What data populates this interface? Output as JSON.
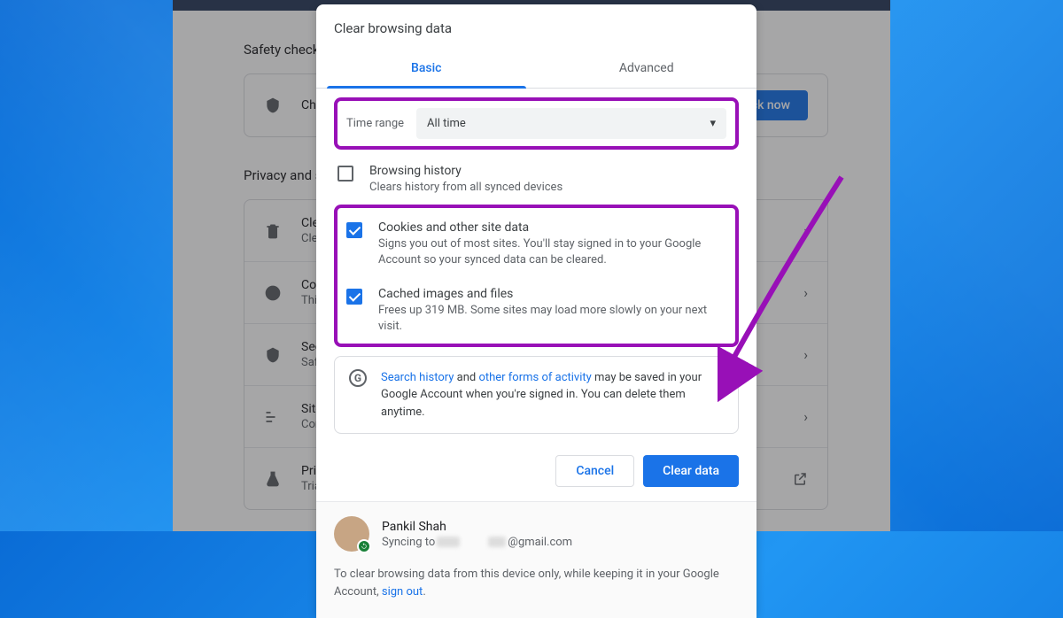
{
  "dialog": {
    "title": "Clear browsing data",
    "tabs": {
      "basic": "Basic",
      "advanced": "Advanced"
    },
    "time_label": "Time range",
    "time_value": "All time",
    "items": [
      {
        "title": "Browsing history",
        "sub": "Clears history from all synced devices"
      },
      {
        "title": "Cookies and other site data",
        "sub": "Signs you out of most sites. You'll stay signed in to your Google Account so your synced data can be cleared."
      },
      {
        "title": "Cached images and files",
        "sub": "Frees up 319 MB. Some sites may load more slowly on your next visit."
      }
    ],
    "info": {
      "link1": "Search history",
      "mid": " and ",
      "link2": "other forms of activity",
      "rest": " may be saved in your Google Account when you're signed in. You can delete them anytime."
    },
    "cancel": "Cancel",
    "clear": "Clear data",
    "user": {
      "name": "Pankil Shah",
      "sync_prefix": "Syncing to ",
      "email_suffix": "@gmail.com"
    },
    "footer": {
      "text": "To clear browsing data from this device only, while keeping it in your Google Account, ",
      "link": "sign out"
    }
  },
  "bg": {
    "safety_label": "Safety check",
    "chrome_text": "Chro",
    "check_now": "eck now",
    "privacy_label": "Privacy and s",
    "rows": [
      {
        "t1": "Clea",
        "t2": "Clea"
      },
      {
        "t1": "Cook",
        "t2": "Thirc"
      },
      {
        "t1": "Secu",
        "t2": "Safe"
      },
      {
        "t1": "Site",
        "t2": "Cont"
      },
      {
        "t1": "Priva",
        "t2": "Trial"
      }
    ]
  }
}
